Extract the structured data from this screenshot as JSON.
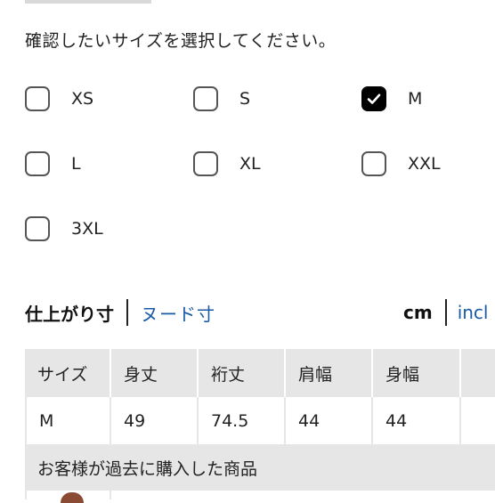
{
  "instruction": "確認したいサイズを選択してください。",
  "sizes": [
    {
      "label": "XS",
      "checked": false
    },
    {
      "label": "S",
      "checked": false
    },
    {
      "label": "M",
      "checked": true
    },
    {
      "label": "L",
      "checked": false
    },
    {
      "label": "XL",
      "checked": false
    },
    {
      "label": "XXL",
      "checked": false
    },
    {
      "label": "3XL",
      "checked": false
    }
  ],
  "tabs": {
    "active": "仕上がり寸",
    "inactive": "ヌード寸"
  },
  "units": {
    "active": "cm",
    "inactive": "incl"
  },
  "table": {
    "headers": [
      "サイズ",
      "身丈",
      "裄丈",
      "肩幅",
      "身幅",
      ""
    ],
    "rows": [
      [
        "M",
        "49",
        "74.5",
        "44",
        "44",
        ""
      ]
    ],
    "purchased_label": "お客様が過去に購入した商品"
  },
  "colors": {
    "link": "#1a5aa6",
    "header_bg": "#e6e6e6",
    "checked_box": "#000000"
  }
}
